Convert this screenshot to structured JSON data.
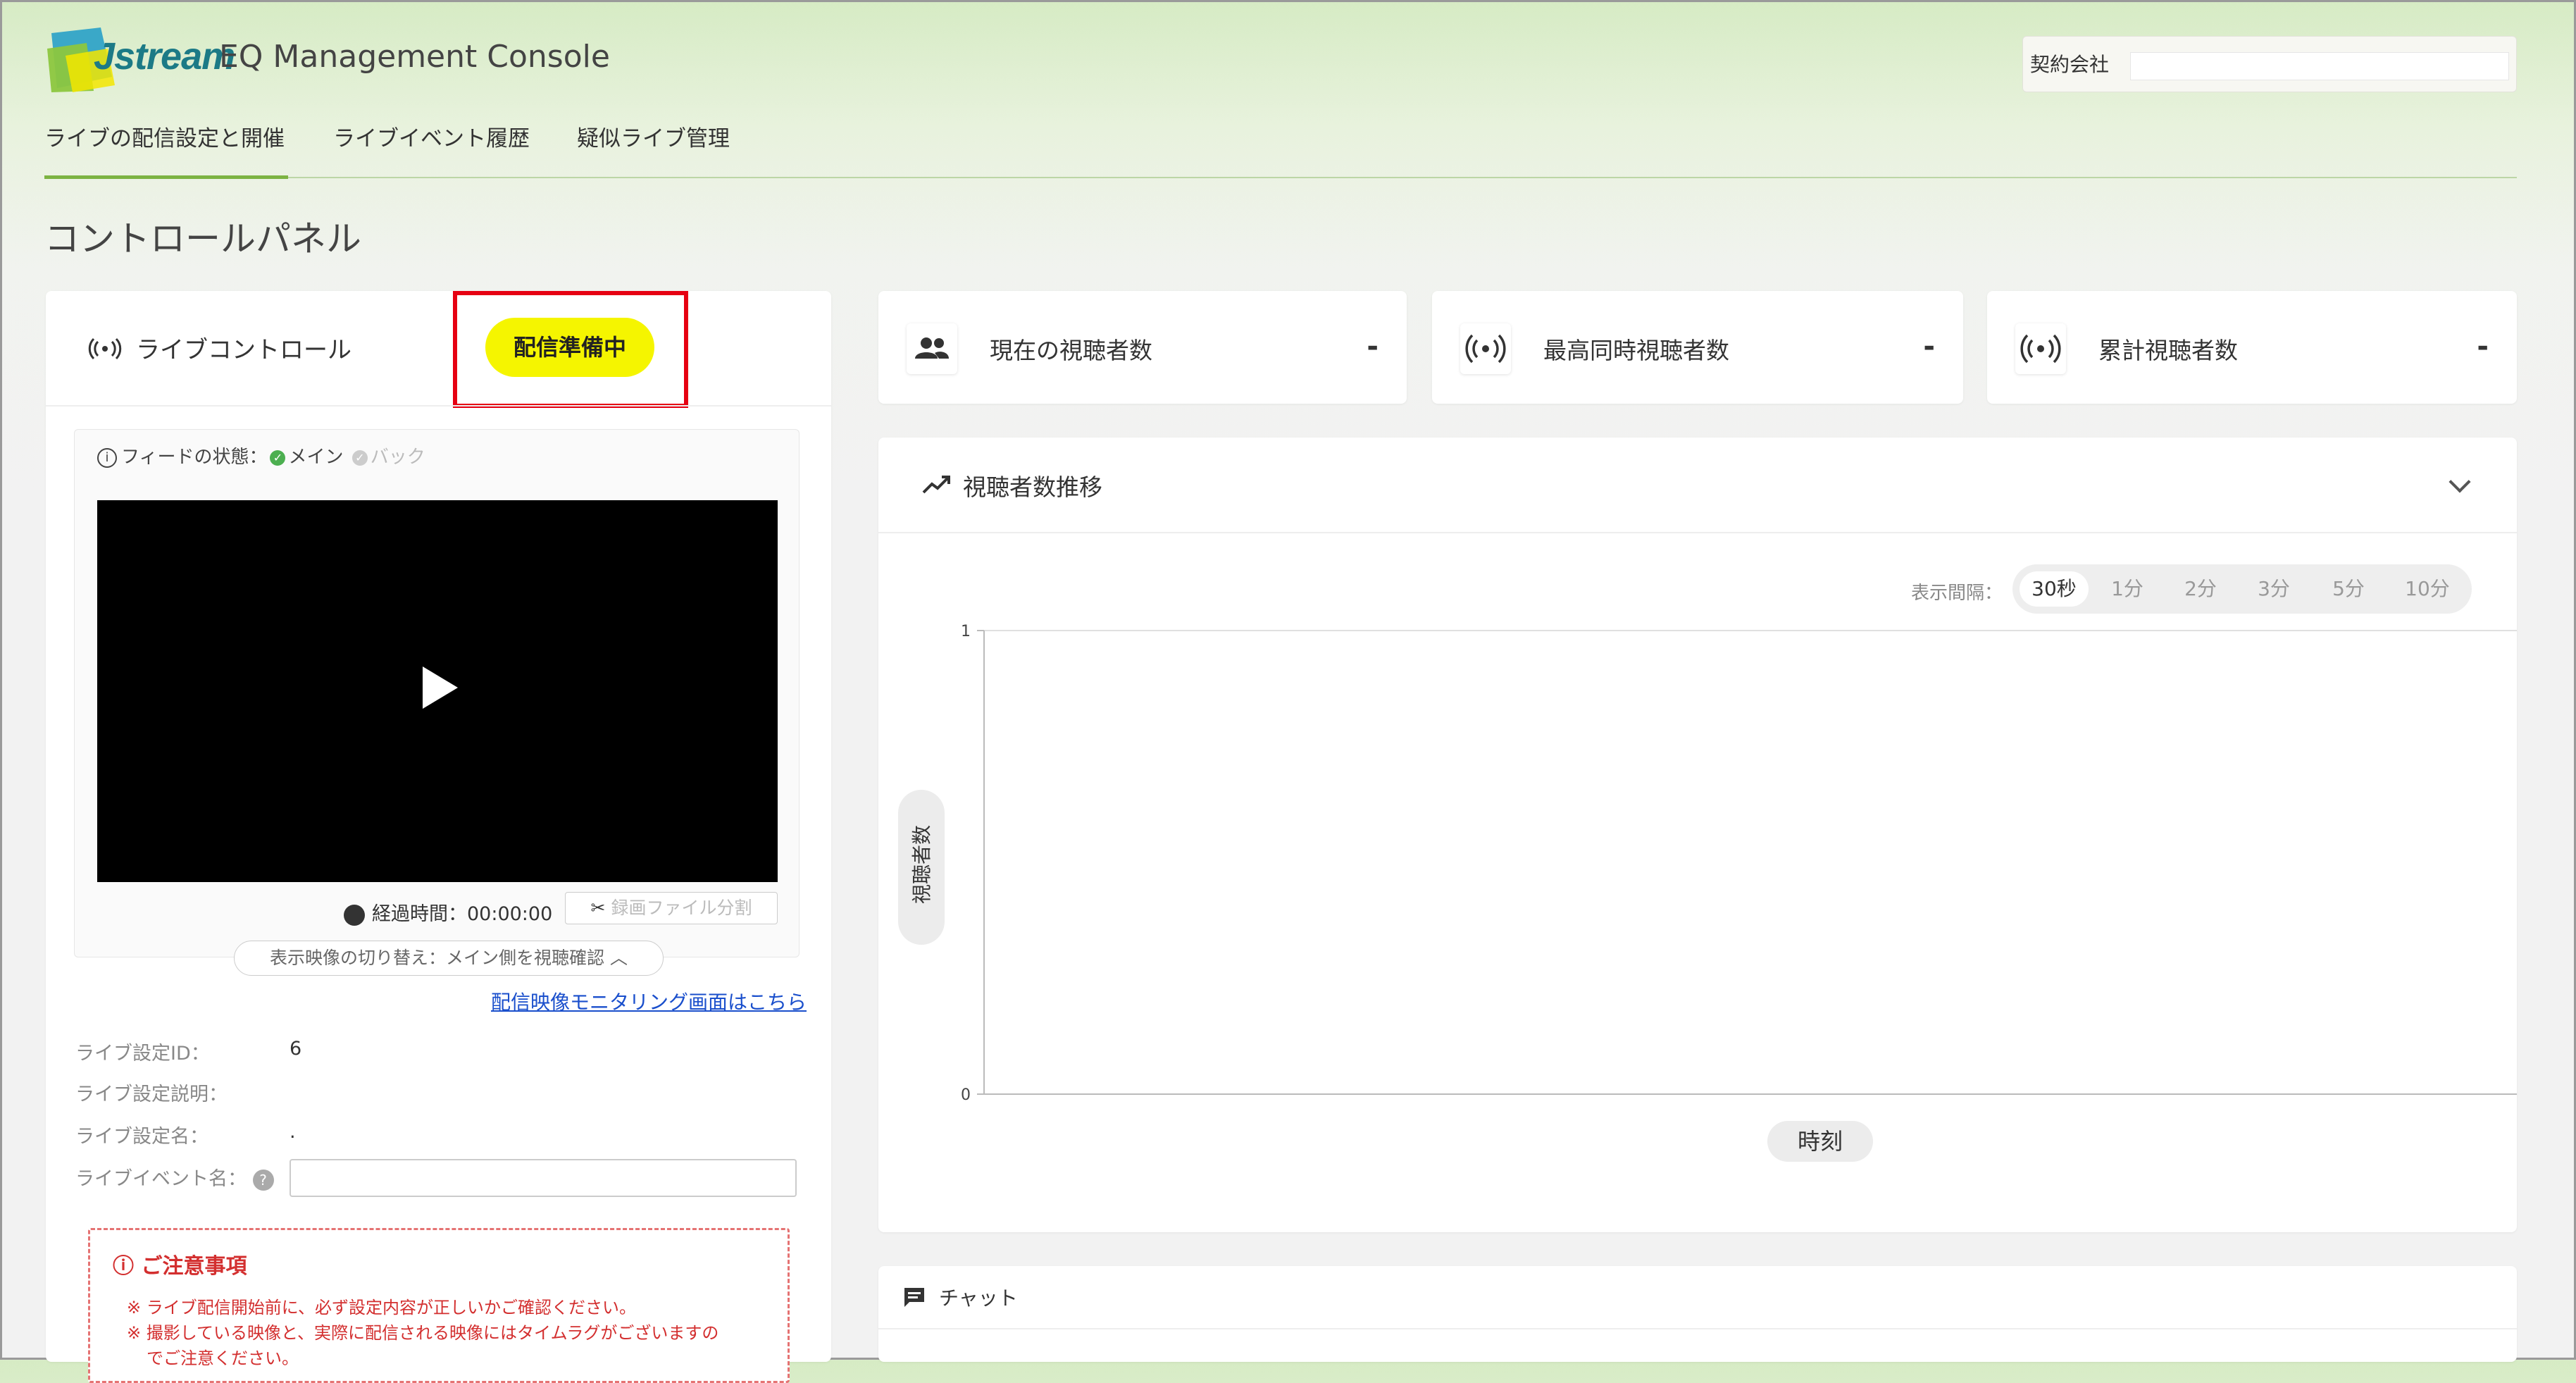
{
  "header": {
    "logo_text": "Jstream",
    "app_title": "EQ Management Console",
    "company_label": "契約会社",
    "company_value": ""
  },
  "nav": {
    "tabs": [
      {
        "label": "ライブの配信設定と開催",
        "active": true
      },
      {
        "label": "ライブイベント履歴",
        "active": false
      },
      {
        "label": "疑似ライブ管理",
        "active": false
      }
    ]
  },
  "page_title": "コントロールパネル",
  "live_control": {
    "title": "ライブコントロール",
    "status": "配信準備中",
    "status_color": "#f5f500",
    "highlight_color": "#e60012",
    "feed_status_label": "フィードの状態：",
    "feed_main": "メイン",
    "feed_backup": "バック",
    "elapsed": "経過時間：00:00:00",
    "split_button": "録画ファイル分割",
    "switch_view": "表示映像の切り替え：メイン側を視聴確認",
    "monitor_link": "配信映像モニタリング画面はこちら",
    "fields": [
      {
        "label": "ライブ設定ID：",
        "value": "6"
      },
      {
        "label": "ライブ設定説明：",
        "value": ""
      },
      {
        "label": "ライブ設定名：",
        "value": "."
      },
      {
        "label": "ライブイベント名：",
        "value": ""
      }
    ],
    "event_name_value": "",
    "notice": {
      "title": "ご注意事項",
      "lines": [
        "※ ライブ配信開始前に、必ず設定内容が正しいかご確認ください。",
        "※ 撮影している映像と、実際に配信される映像にはタイムラグがございますの",
        "でご注意ください。"
      ]
    }
  },
  "stats": [
    {
      "label": "現在の視聴者数",
      "value": "-",
      "icon": "people-icon"
    },
    {
      "label": "最高同時視聴者数",
      "value": "-",
      "icon": "broadcast-icon"
    },
    {
      "label": "累計視聴者数",
      "value": "-",
      "icon": "broadcast-icon"
    }
  ],
  "viewer_chart": {
    "title": "視聴者数推移",
    "interval_label": "表示間隔：",
    "intervals": [
      "30秒",
      "1分",
      "2分",
      "3分",
      "5分",
      "10分"
    ],
    "selected_interval": "30秒"
  },
  "chart_data": {
    "type": "line",
    "series": [],
    "xlabel": "時刻",
    "ylabel": "視聴者数",
    "ylim": [
      0,
      1
    ],
    "y_ticks": [
      "1",
      "0"
    ]
  },
  "chat": {
    "title": "チャット"
  },
  "colors": {
    "accent_green": "#7cb342",
    "link_blue": "#1a4fcc",
    "notice_red": "#d32f2f"
  }
}
